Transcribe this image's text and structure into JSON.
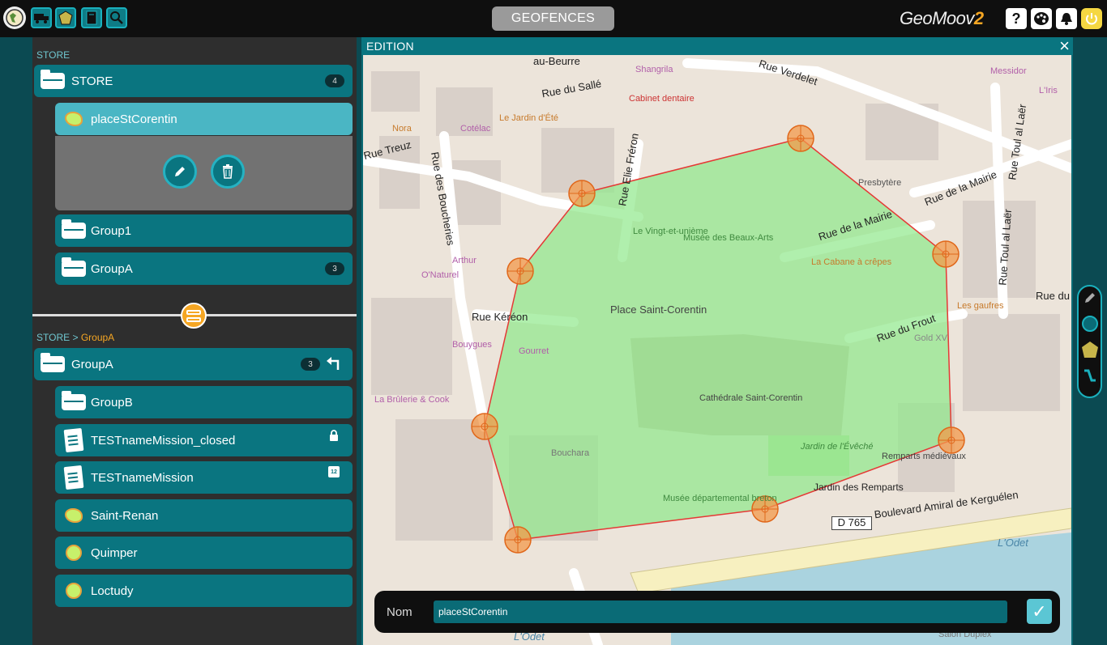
{
  "topbar": {
    "title": "GEOFENCES",
    "brand_main": "GeoMoov",
    "brand_suffix": "2",
    "help_label": "?"
  },
  "left_panel": {
    "top_breadcrumb": "STORE",
    "store_header": {
      "label": "STORE",
      "badge": "4"
    },
    "top_items": [
      {
        "label": "placeStCorentin",
        "type": "polygon",
        "selected": true
      },
      {
        "label": "Group1",
        "type": "group"
      },
      {
        "label": "GroupA",
        "type": "group",
        "badge": "3"
      }
    ],
    "bottom_breadcrumb": {
      "root": "STORE",
      "sep": ">",
      "current": "GroupA"
    },
    "group_header": {
      "label": "GroupA",
      "badge": "3"
    },
    "bottom_items": [
      {
        "label": "GroupB",
        "type": "group"
      },
      {
        "label": "TESTnameMission_closed",
        "type": "mission",
        "status": "locked"
      },
      {
        "label": "TESTnameMission",
        "type": "mission",
        "status": "calendar"
      },
      {
        "label": "Saint-Renan",
        "type": "polygon"
      },
      {
        "label": "Quimper",
        "type": "circle"
      },
      {
        "label": "Loctudy",
        "type": "circle"
      }
    ],
    "calendar_label": "12"
  },
  "edition": {
    "title": "EDITION",
    "close_label": "×",
    "name_label": "Nom",
    "name_value": "placeStCorentin",
    "confirm_label": "✓"
  },
  "map": {
    "roads": [
      {
        "text": "Rue Verdelet"
      },
      {
        "text": "Rue de la Mairie"
      },
      {
        "text": "Rue de la Mairie"
      },
      {
        "text": "Rue Toul al Laër"
      },
      {
        "text": "Rue Toul al Laër"
      },
      {
        "text": "Rue du Frout"
      },
      {
        "text": "Rue Kéréon"
      },
      {
        "text": "Rue Elie Fréron"
      },
      {
        "text": "Rue des Boucheries"
      },
      {
        "text": "Rue du Sallé"
      },
      {
        "text": "Rue Treuz"
      },
      {
        "text": "Boulevard Amiral de Kerguélen"
      },
      {
        "text": "au-Beurre"
      },
      {
        "text": "Rue du"
      }
    ],
    "places": [
      "Place Saint-Corentin",
      "Cathédrale Saint-Corentin",
      "Musée des Beaux-Arts",
      "Le Vingt-et-unième",
      "La Cabane à crêpes",
      "Remparts médiévaux",
      "Jardin des Remparts",
      "Jardin de l'Évêché",
      "Musée départemental breton",
      "Shangrila",
      "Cabinet dentaire",
      "Le Jardin d'Été",
      "Cotélac",
      "Nora",
      "Arthur",
      "O'Naturel",
      "Bouygues",
      "Gourret",
      "Bouchara",
      "La Brûlerie & Cook",
      "Presbytère",
      "Les gaufres",
      "Messidor",
      "L'Iris",
      "Gold XV",
      "D 765",
      "L'Odet",
      "L'Odet",
      "Salon Duplex"
    ],
    "fill_color": "#8ee88a",
    "stroke_color": "#e53935",
    "vertex_color": "#f39a4b"
  }
}
